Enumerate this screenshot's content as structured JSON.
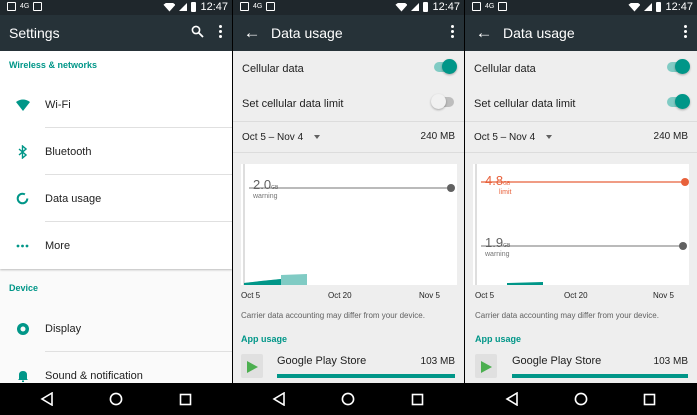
{
  "status": {
    "network": "4G",
    "time": "12:47"
  },
  "settings": {
    "title": "Settings",
    "section_wireless": "Wireless & networks",
    "items_wireless": [
      {
        "label": "Wi-Fi",
        "icon": "wifi-icon"
      },
      {
        "label": "Bluetooth",
        "icon": "bluetooth-icon"
      },
      {
        "label": "Data usage",
        "icon": "data-usage-icon"
      },
      {
        "label": "More",
        "icon": "more-horiz-icon"
      }
    ],
    "section_device": "Device",
    "items_device": [
      {
        "label": "Display",
        "icon": "display-icon"
      },
      {
        "label": "Sound & notification",
        "icon": "bell-icon"
      }
    ]
  },
  "data_usage_left": {
    "title": "Data usage",
    "cellular_data_label": "Cellular data",
    "cellular_data_on": true,
    "limit_label": "Set cellular data limit",
    "limit_on": false,
    "cycle": "Oct 5 – Nov 4",
    "cycle_amount": "240 MB",
    "warning_value": "2.0",
    "warning_unit": "GB",
    "warning_label": "warning",
    "x_ticks": [
      "Oct 5",
      "Oct 20",
      "Nov 5"
    ],
    "note": "Carrier data accounting may differ from your device.",
    "app_usage_head": "App usage",
    "app_name": "Google Play Store",
    "app_amount": "103 MB"
  },
  "data_usage_right": {
    "title": "Data usage",
    "cellular_data_label": "Cellular data",
    "cellular_data_on": true,
    "limit_label": "Set cellular data limit",
    "limit_on": true,
    "cycle": "Oct 5 – Nov 4",
    "cycle_amount": "240 MB",
    "limit_value": "4.8",
    "limit_unit": "GB",
    "limit_word": "limit",
    "warning_value": "1.9",
    "warning_unit": "GB",
    "warning_label": "warning",
    "x_ticks": [
      "Oct 5",
      "Oct 20",
      "Nov 5"
    ],
    "note": "Carrier data accounting may differ from your device.",
    "app_usage_head": "App usage",
    "app_name": "Google Play Store",
    "app_amount": "103 MB"
  },
  "colors": {
    "accent": "#009688",
    "limit": "#e8613b",
    "appbar": "#263238"
  }
}
